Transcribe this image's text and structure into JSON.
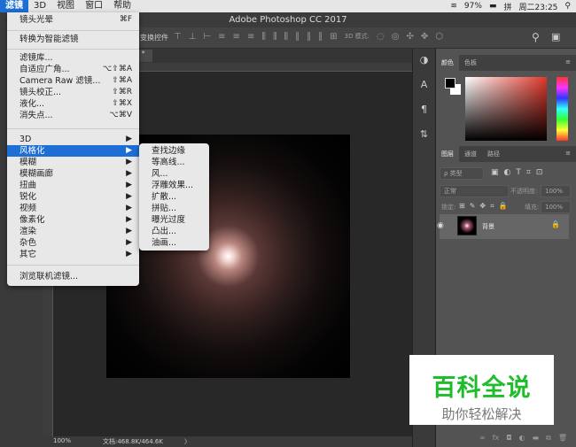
{
  "menubar": {
    "items": [
      "滤镜",
      "3D",
      "视图",
      "窗口",
      "帮助"
    ],
    "battery": "97%",
    "clock": "周二23:25",
    "ime": "拼"
  },
  "window": {
    "title": "Adobe Photoshop CC 2017"
  },
  "options": {
    "label": "变换控件",
    "mode3d": "3D 模式:"
  },
  "tab": {
    "label": ") *"
  },
  "status": {
    "zoom": "100%",
    "doc": "文档:468.8K/464.6K",
    "arrow": "〉"
  },
  "filter_menu": {
    "items": [
      {
        "label": "镜头光晕",
        "shortcut": "⌘F"
      },
      {
        "label": "转换为智能滤镜"
      },
      {
        "label": "滤镜库..."
      },
      {
        "label": "自适应广角...",
        "shortcut": "⌥⇧⌘A"
      },
      {
        "label": "Camera Raw 滤镜...",
        "shortcut": "⇧⌘A"
      },
      {
        "label": "镜头校正...",
        "shortcut": "⇧⌘R"
      },
      {
        "label": "液化...",
        "shortcut": "⇧⌘X"
      },
      {
        "label": "消失点...",
        "shortcut": "⌥⌘V"
      },
      {
        "label": "3D",
        "shortcut": "▶"
      },
      {
        "label": "风格化",
        "shortcut": "▶"
      },
      {
        "label": "模糊",
        "shortcut": "▶"
      },
      {
        "label": "模糊画廊",
        "shortcut": "▶"
      },
      {
        "label": "扭曲",
        "shortcut": "▶"
      },
      {
        "label": "锐化",
        "shortcut": "▶"
      },
      {
        "label": "视频",
        "shortcut": "▶"
      },
      {
        "label": "像素化",
        "shortcut": "▶"
      },
      {
        "label": "渲染",
        "shortcut": "▶"
      },
      {
        "label": "杂色",
        "shortcut": "▶"
      },
      {
        "label": "其它",
        "shortcut": "▶"
      },
      {
        "label": "浏览联机滤镜..."
      }
    ],
    "highlighted": "风格化"
  },
  "stylize_submenu": [
    "查找边缘",
    "等高线...",
    "风...",
    "浮雕效果...",
    "扩散...",
    "拼贴...",
    "曝光过度",
    "凸出...",
    "油画..."
  ],
  "color_panel": {
    "tabs": [
      "颜色",
      "色板"
    ],
    "hue_color": "#e0372a"
  },
  "layers_panel": {
    "tabs": [
      "图层",
      "通道",
      "路径"
    ],
    "filter": "ρ 类型",
    "blend": "正常",
    "opacity_label": "不透明度:",
    "opacity": "100%",
    "lock_label": "锁定:",
    "fill_label": "填充:",
    "fill": "100%",
    "layer_name": "背景"
  },
  "watermark": {
    "title": "百科全说",
    "subtitle": "助你轻松解决",
    "color": "#1fbd2c"
  }
}
